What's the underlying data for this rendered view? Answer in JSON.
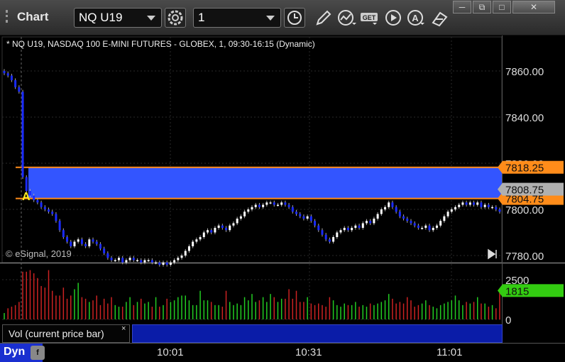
{
  "window": {
    "title": "Chart",
    "symbol": "NQ U19",
    "interval": "1",
    "controls": [
      "minimize",
      "restore",
      "maximize",
      "close"
    ]
  },
  "toolbar": {
    "icons": [
      "settings-gear-icon",
      "clock-icon",
      "pencil-draw-icon",
      "studies-icon",
      "get-data-icon",
      "play-icon",
      "alert-icon",
      "link-icon"
    ]
  },
  "chart": {
    "info": "* NQ U19, NASDAQ 100 E-MINI FUTURES - GLOBEX, 1, 09:30-16:15 (Dynamic)",
    "copyright": "© eSignal, 2019",
    "marker_label": "A",
    "price_labels": {
      "upper_level": "7818.25",
      "last": "7808.75",
      "lower_level": "7804.75"
    },
    "volume_label": "1815",
    "colors": {
      "up": "#ffffff",
      "down": "#1a2bff",
      "level_line": "#ff8c1a",
      "zone": "#3355ff",
      "volume_up": "#22cc22",
      "volume_down": "#cc2222",
      "last_badge": "#b0b0b0",
      "volume_badge": "#33cc11"
    },
    "vol_panel_label": "Vol (current price bar)",
    "vol_close_glyph": "×",
    "footer_mode": "Dyn",
    "footer_icon_text": "f"
  },
  "chart_data": {
    "type": "candlestick",
    "price_axis": {
      "ticks": [
        "7860.00",
        "7840.00",
        "7820.00",
        "7800.00",
        "7780.00"
      ],
      "range": [
        7775,
        7862
      ]
    },
    "volume_axis": {
      "ticks": [
        "2500",
        "0"
      ],
      "range": [
        0,
        3500
      ]
    },
    "time_axis": {
      "ticks": [
        "10:01",
        "10:31",
        "11:01"
      ]
    },
    "closes": [
      7859,
      7858,
      7856,
      7853,
      7851,
      7814,
      7808,
      7806,
      7804,
      7803,
      7801,
      7800,
      7799,
      7798,
      7795,
      7791,
      7788,
      7786,
      7784,
      7786,
      7787,
      7785,
      7784,
      7787,
      7786,
      7785,
      7783,
      7781,
      7779,
      7778,
      7778,
      7779,
      7777,
      7778,
      7779,
      7778,
      7778,
      7777,
      7778,
      7778,
      7777,
      7777,
      7776,
      7777,
      7776,
      7777,
      7778,
      7779,
      7780,
      7782,
      7784,
      7786,
      7787,
      7788,
      7790,
      7791,
      7790,
      7792,
      7793,
      7792,
      7791,
      7793,
      7794,
      7796,
      7797,
      7799,
      7800,
      7801,
      7802,
      7801,
      7802,
      7803,
      7803,
      7802,
      7802,
      7803,
      7802,
      7801,
      7799,
      7798,
      7797,
      7796,
      7797,
      7795,
      7793,
      7791,
      7789,
      7787,
      7786,
      7788,
      7790,
      7791,
      7792,
      7791,
      7792,
      7793,
      7792,
      7794,
      7795,
      7794,
      7796,
      7798,
      7800,
      7801,
      7803,
      7801,
      7799,
      7797,
      7796,
      7795,
      7794,
      7793,
      7792,
      7792,
      7793,
      7791,
      7792,
      7793,
      7795,
      7797,
      7799,
      7800,
      7801,
      7802,
      7803,
      7802,
      7803,
      7802,
      7803,
      7801,
      7802,
      7801,
      7801,
      7800,
      7799
    ],
    "volumes": [
      400,
      700,
      800,
      900,
      1100,
      3000,
      3000,
      3100,
      2900,
      2600,
      2100,
      2000,
      3100,
      1800,
      1500,
      1500,
      2000,
      1300,
      1500,
      1900,
      2300,
      1400,
      1300,
      1100,
      1200,
      1500,
      900,
      1300,
      1000,
      1400,
      900,
      800,
      800,
      1100,
      1400,
      900,
      1100,
      1300,
      1000,
      1100,
      800,
      1400,
      800,
      900,
      1300,
      1100,
      1200,
      1400,
      1500,
      1500,
      1200,
      900,
      900,
      1800,
      1200,
      1200,
      1100,
      900,
      900,
      800,
      1800,
      1100,
      900,
      1000,
      900,
      1400,
      1200,
      1600,
      1100,
      1200,
      1400,
      1100,
      1600,
      1400,
      1100,
      1300,
      1300,
      1900,
      1300,
      1800,
      1100,
      1100,
      1400,
      1000,
      900,
      1000,
      900,
      800,
      1400,
      1200,
      900,
      800,
      1000,
      900,
      900,
      1100,
      800,
      900,
      800,
      1000,
      900,
      1000,
      1100,
      1200,
      1600,
      1300,
      1000,
      1100,
      1000,
      1400,
      1200,
      800,
      900,
      1000,
      1200,
      900,
      800,
      700,
      900,
      1000,
      1100,
      1200,
      1500,
      1200,
      900,
      1100,
      1000,
      1100,
      1400,
      1000,
      1000,
      800,
      900,
      700,
      1800
    ],
    "levels": [
      7818.25,
      7804.75
    ],
    "last_price": 7808.75,
    "last_volume": 1815
  }
}
